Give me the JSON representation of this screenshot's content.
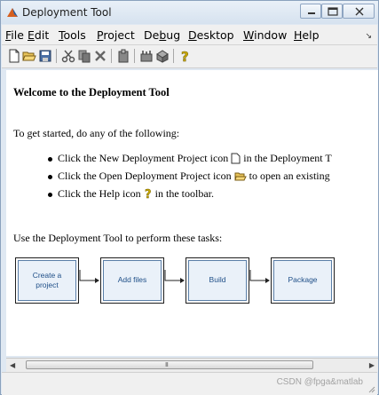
{
  "window": {
    "title": "Deployment Tool"
  },
  "menubar": {
    "items": [
      {
        "key": "F",
        "rest": "ile"
      },
      {
        "key": "E",
        "rest": "dit"
      },
      {
        "key": "T",
        "rest": "ools"
      },
      {
        "key": "P",
        "rest": "roject"
      },
      {
        "pre": "De",
        "key": "b",
        "rest": "ug"
      },
      {
        "key": "D",
        "rest": "esktop"
      },
      {
        "key": "W",
        "rest": "indow"
      },
      {
        "key": "H",
        "rest": "elp"
      }
    ]
  },
  "toolbar": {
    "icons": [
      "new-document-icon",
      "open-folder-icon",
      "save-icon",
      "cut-icon",
      "copy-icon",
      "delete-icon",
      "paste-icon",
      "settings-icon",
      "package-icon",
      "help-icon"
    ]
  },
  "content": {
    "welcome": "Welcome to the Deployment Tool",
    "get_started": "To get started, do any of the following:",
    "bullets": [
      {
        "before": "Click the New Deployment Project icon",
        "after": "in the Deployment T"
      },
      {
        "before": "Click the Open Deployment Project icon",
        "after": "to open an existing"
      },
      {
        "before": "Click the Help icon",
        "after": "in the toolbar."
      }
    ],
    "use_text": "Use the Deployment Tool to perform these tasks:",
    "tasks": [
      {
        "line1": "Create a",
        "line2": "project"
      },
      {
        "line1": "Add files",
        "line2": ""
      },
      {
        "line1": "Build",
        "line2": ""
      },
      {
        "line1": "Package",
        "line2": ""
      }
    ]
  },
  "scrollbar": {
    "grip": "III"
  },
  "statusbar": {
    "watermark": "CSDN @fpga&matlab"
  },
  "colors": {
    "flow_fill": "#eaf1f9",
    "flow_border": "#5b7fa8",
    "flow_text": "#1f4f88"
  }
}
